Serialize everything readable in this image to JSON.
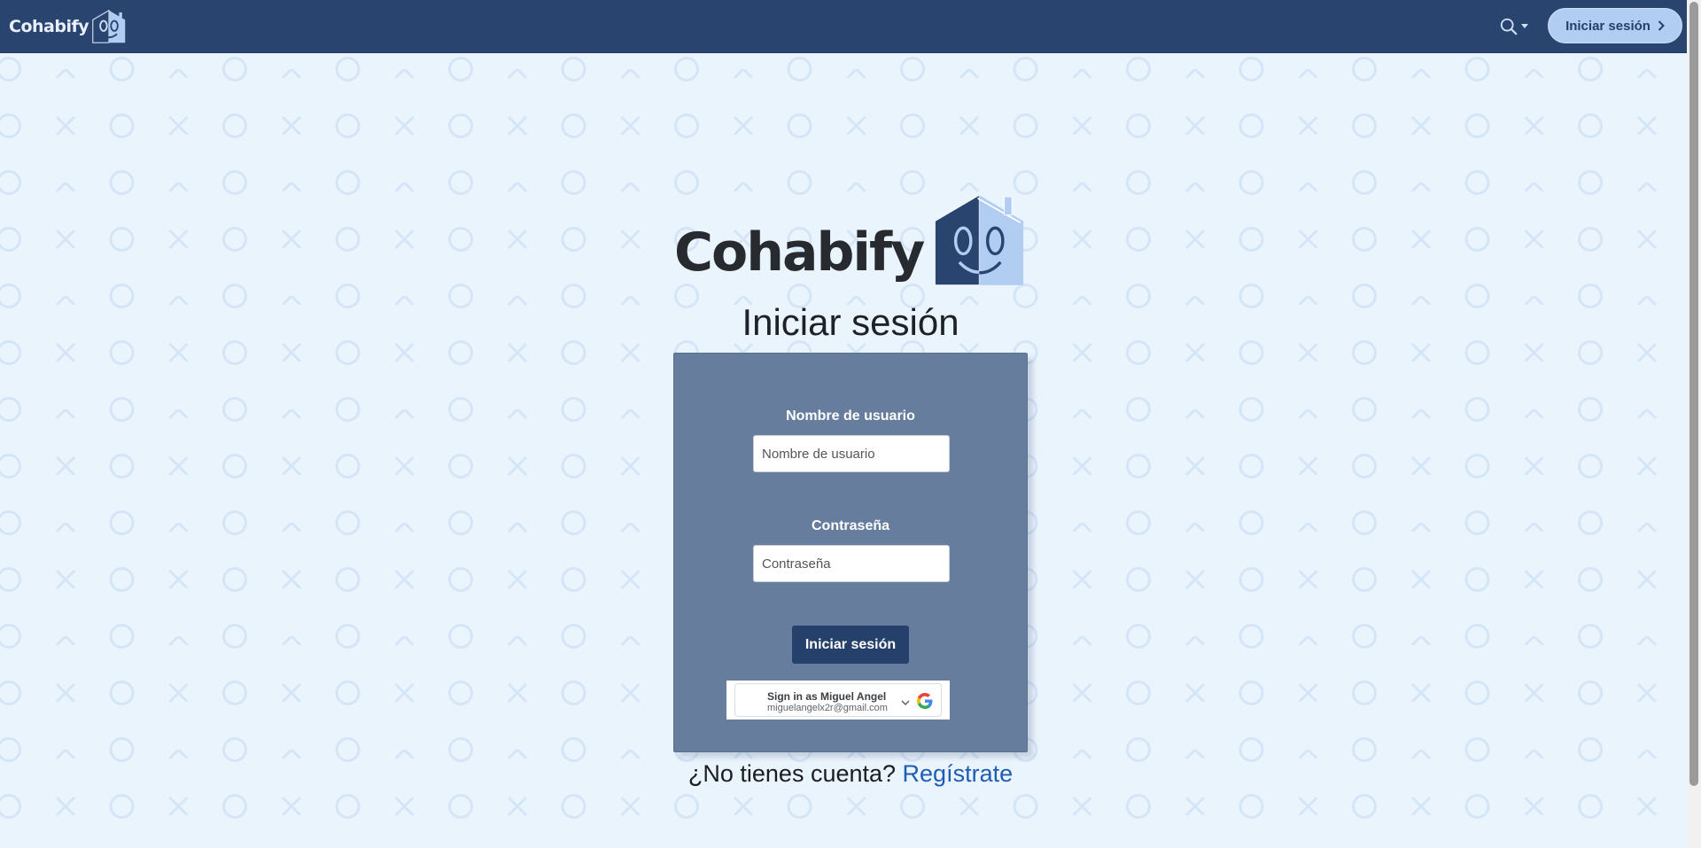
{
  "navbar": {
    "brand": "Cohabify",
    "search_icon": "search-icon",
    "login_label": "Iniciar sesión",
    "login_icon": "chevron-right-icon",
    "background": "#2a4470"
  },
  "hero": {
    "brand": "Cohabify"
  },
  "page": {
    "title": "Iniciar sesión",
    "background": "#eaf4fd"
  },
  "form": {
    "username_label": "Nombre de usuario",
    "username_placeholder": "Nombre de usuario",
    "username_value": "",
    "password_label": "Contraseña",
    "password_placeholder": "Contraseña",
    "password_value": "",
    "submit_label": "Iniciar sesión",
    "card_color": "#667d9d",
    "button_color": "#24406b"
  },
  "google_signin": {
    "title": "Sign in as Miguel Angel",
    "email": "miguelangelx2r@gmail.com",
    "icon": "google-g-icon"
  },
  "footer": {
    "prompt": "¿No tienes cuenta?",
    "register_link": "Regístrate",
    "link_color": "#1f5cb3"
  }
}
